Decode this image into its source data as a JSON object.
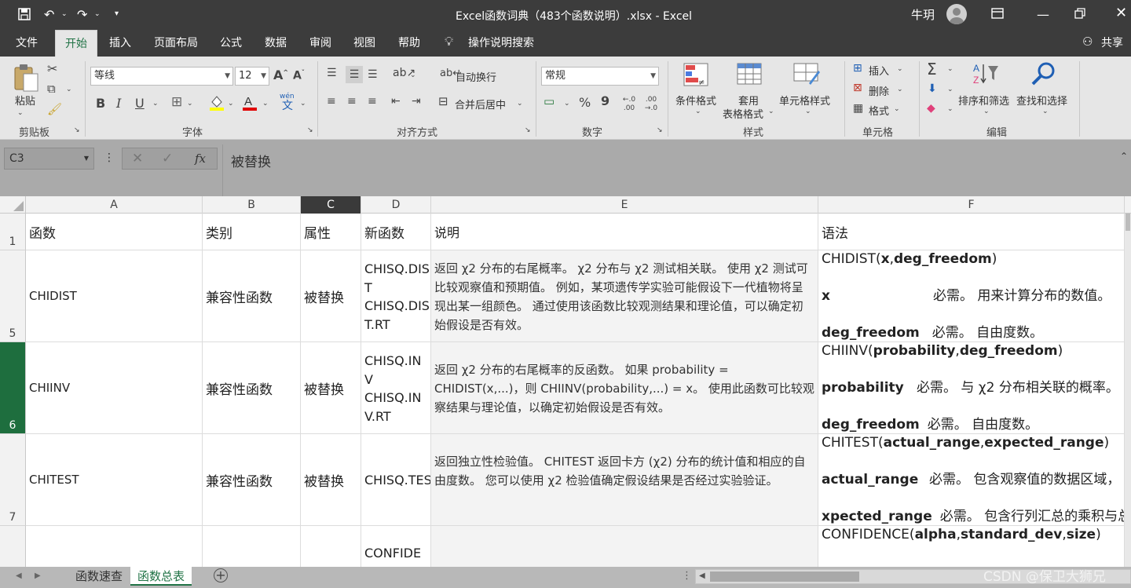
{
  "window": {
    "title": "Excel函数词典（483个函数说明）.xlsx  -  Excel",
    "user": "牛玥"
  },
  "tabs": [
    "文件",
    "开始",
    "插入",
    "页面布局",
    "公式",
    "数据",
    "审阅",
    "视图",
    "帮助"
  ],
  "active_tab": "开始",
  "tell_me": "操作说明搜索",
  "share": "共享",
  "ribbon": {
    "clipboard": {
      "paste": "粘贴",
      "group": "剪贴板"
    },
    "font": {
      "name": "等线",
      "size": "12",
      "group": "字体",
      "bold": "B",
      "italic": "I",
      "underline": "U",
      "phonetic": "wén"
    },
    "alignment": {
      "wrap": "自动换行",
      "merge": "合并后居中",
      "group": "对齐方式"
    },
    "number": {
      "format": "常规",
      "percent": "%",
      "comma": "9",
      "inc": "←.0 .00",
      "dec": ".00 →.0",
      "group": "数字"
    },
    "styles": {
      "conditional": "条件格式",
      "table_line1": "套用",
      "table_line2": "表格格式",
      "cell_styles": "单元格样式",
      "group": "样式"
    },
    "cells": {
      "insert": "插入",
      "delete": "删除",
      "format": "格式",
      "group": "单元格"
    },
    "editing": {
      "sort_filter": "排序和筛选",
      "find_select": "查找和选择",
      "group": "编辑"
    }
  },
  "formula_bar": {
    "name_box": "C3",
    "fx": "fx",
    "content": "被替换"
  },
  "columns": [
    "A",
    "B",
    "C",
    "D",
    "E",
    "F"
  ],
  "header_row": {
    "num": "1",
    "a": "函数",
    "b": "类别",
    "c": "属性",
    "d": "新函数",
    "e": "说明",
    "f": "语法"
  },
  "rows": [
    {
      "num": "5",
      "a": "CHIDIST",
      "b": "兼容性函数",
      "c": "被替换",
      "d1": "CHISQ.DIS",
      "d2": "T",
      "d3": "CHISQ.DIS",
      "d4": "T.RT",
      "e": "返回 χ2 分布的右尾概率。 χ2 分布与 χ2 测试相关联。 使用 χ2 测试可比较观察值和预期值。 例如，某项遗传学实验可能假设下一代植物将呈现出某一组颜色。 通过使用该函数比较观测结果和理论值，可以确定初始假设是否有效。",
      "f_fn": "CHIDIST(",
      "f_p1": "x",
      "f_sep": ",",
      "f_p2": "deg_freedom",
      "f_close": ")",
      "f_l2_name": "x",
      "f_l2_desc": "必需。 用来计算分布的数值。",
      "f_l3_name": "deg_freedom",
      "f_l3_desc": "必需。 自由度数。"
    },
    {
      "num": "6",
      "a": "CHIINV",
      "b": "兼容性函数",
      "c": "被替换",
      "d1": "CHISQ.IN",
      "d2": "V",
      "d3": "CHISQ.IN",
      "d4": "V.RT",
      "e": "返回 χ2 分布的右尾概率的反函数。 如果 probability = CHIDIST(x,...)，则 CHIINV(probability,...) = x。 使用此函数可比较观察结果与理论值，以确定初始假设是否有效。",
      "f_fn": "CHIINV(",
      "f_p1": "probability",
      "f_sep": ",",
      "f_p2": "deg_freedom",
      "f_close": ")",
      "f_l2_name": "probability",
      "f_l2_desc": "必需。 与 χ2 分布相关联的概率。",
      "f_l3_name": "deg_freedom",
      "f_l3_desc": "必需。 自由度数。"
    },
    {
      "num": "7",
      "a": "CHITEST",
      "b": "兼容性函数",
      "c": "被替换",
      "d1": "CHISQ.TEST",
      "e": "返回独立性检验值。 CHITEST 返回卡方 (χ2) 分布的统计值和相应的自由度数。 您可以使用 χ2 检验值确定假设结果是否经过实验验证。",
      "f_fn": "CHITEST(",
      "f_p1": "actual_range",
      "f_sep": ",",
      "f_p2": "expected_range",
      "f_close": ")",
      "f_l2_name": "actual_range",
      "f_l2_desc": "必需。 包含观察值的数据区域，",
      "f_l3_name": "xpected_range",
      "f_l3_desc": "必需。 包含行列汇总的乘积与总"
    },
    {
      "num": "",
      "a": "",
      "b": "",
      "c": "",
      "d1": "CONFIDE",
      "f_fn": "CONFIDENCE(",
      "f_p1": "alpha",
      "f_sep": ",",
      "f_p2": "standard_dev",
      "f_sep2": ",",
      "f_p3": "size",
      "f_close": ")"
    }
  ],
  "sheets": [
    "函数速查",
    "函数总表"
  ],
  "active_sheet": "函数总表",
  "watermark": "CSDN @保卫大狮兄",
  "colors": {
    "excel_green": "#217346",
    "dark_chrome": "#3c3c3c",
    "ribbon_bg": "#e6e6e6"
  }
}
